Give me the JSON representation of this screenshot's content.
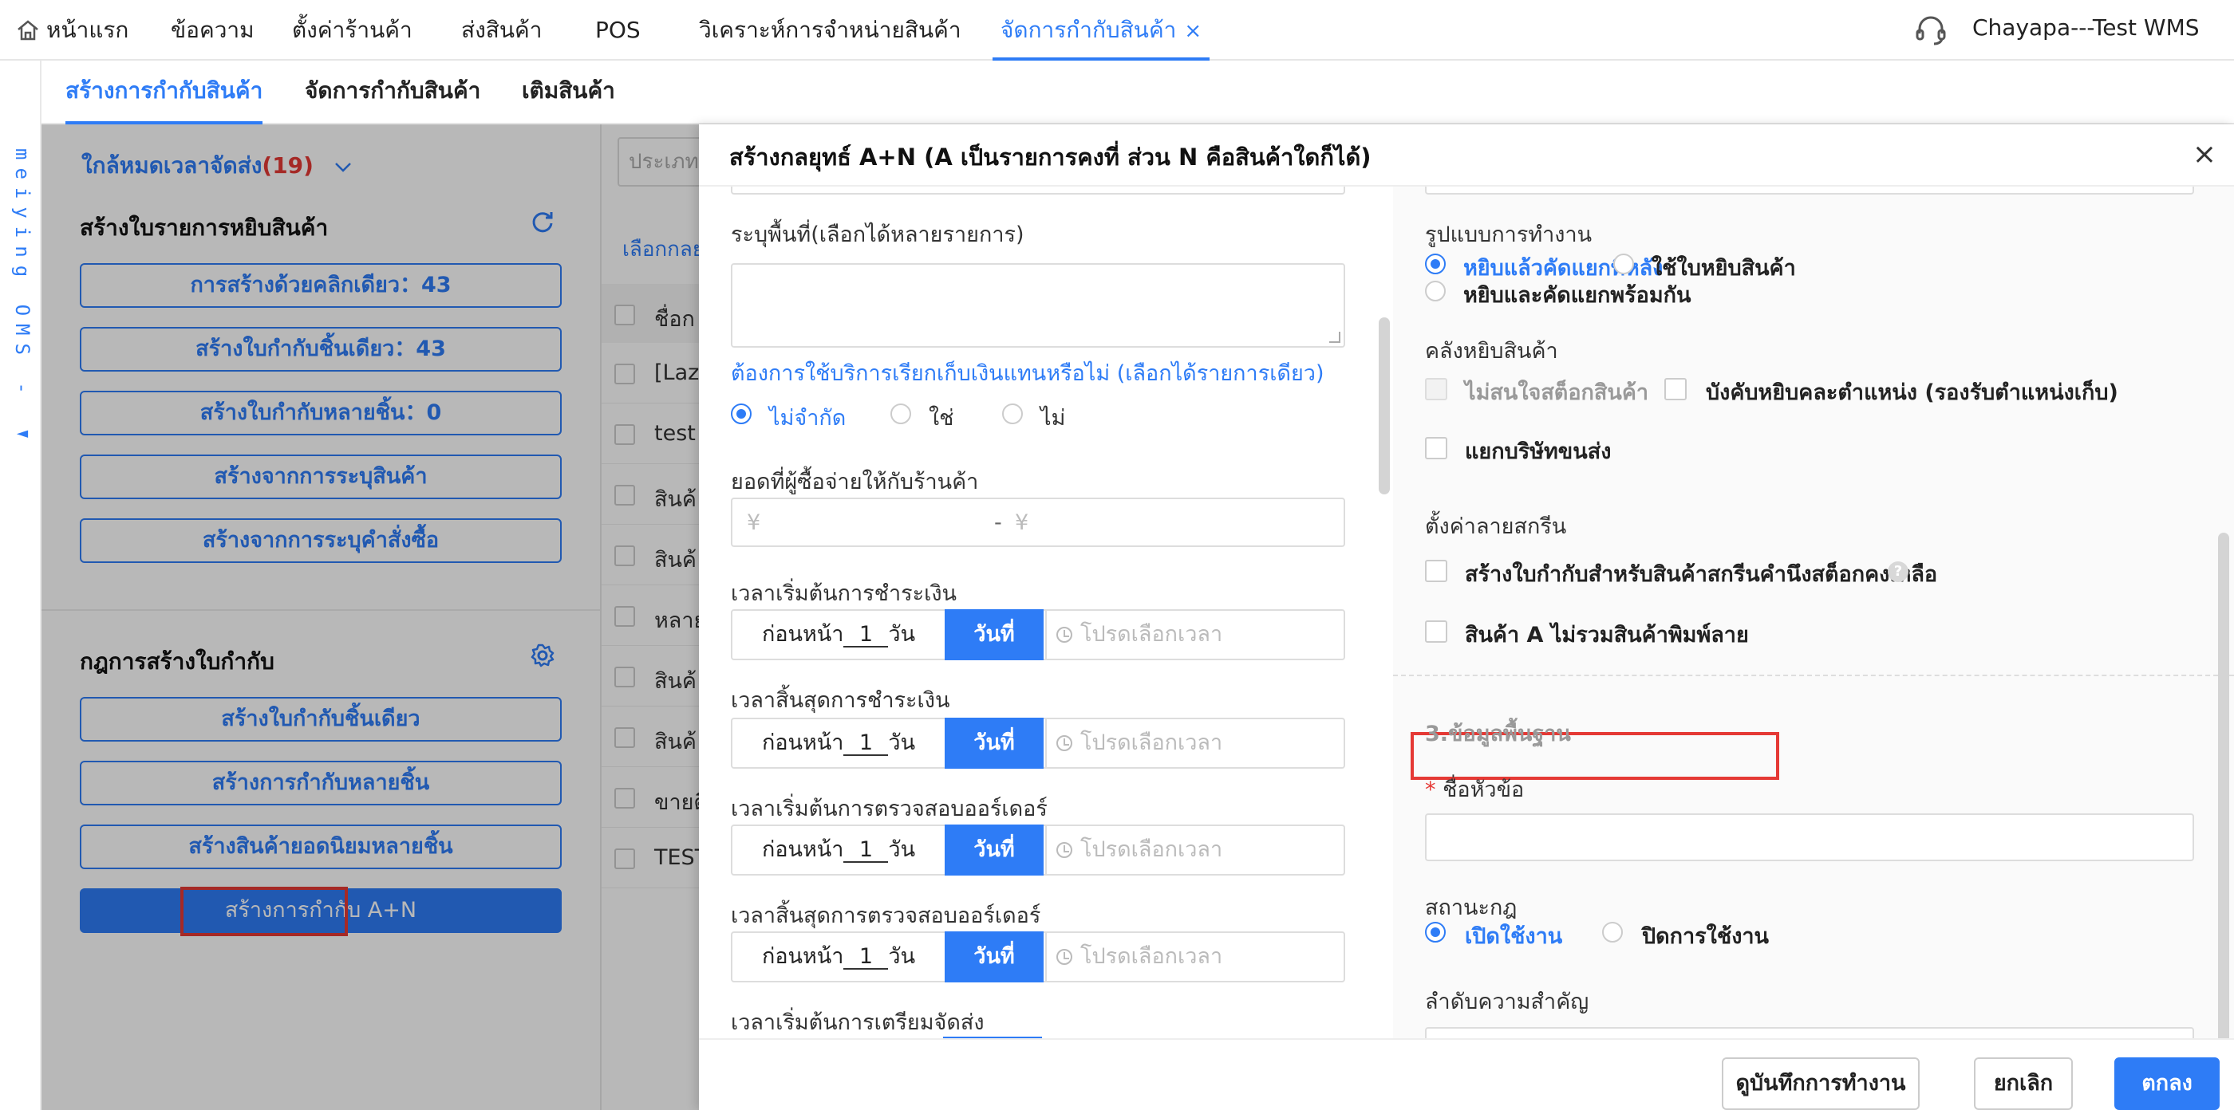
{
  "topnav": {
    "home": "หน้าแรก",
    "items": [
      "ข้อความ",
      "ตั้งค่าร้านค้า",
      "ส่งสินค้า",
      "POS",
      "วิเคราะห์การจำหน่ายสินค้า"
    ],
    "active": "จัดการกำกับสินค้า",
    "close": "×",
    "user": "Chayapa---Test WMS"
  },
  "vertical_text": "meiying OMS - ◄",
  "subtabs": [
    "สร้างการกำกับสินค้า",
    "จัดการกำกับสินค้า",
    "เติมสินค้า"
  ],
  "left": {
    "timeout_label": "ใกล้หมดเวลาจัดส่ง",
    "timeout_count": "(19)",
    "section1": "สร้างใบรายการหยิบสินค้า",
    "buttons1": [
      "การสร้างด้วยคลิกเดียว：43",
      "สร้างใบกำกับชิ้นเดียว：43",
      "สร้างใบกำกับหลายชิ้น：0",
      "สร้างจากการระบุสินค้า",
      "สร้างจากการระบุคำสั่งซื้อ"
    ],
    "section2": "กฎการสร้างใบกำกับ",
    "buttons2": [
      "สร้างใบกำกับชิ้นเดียว",
      "สร้างการกำกับหลายชิ้น",
      "สร้างสินค้ายอดนิยมหลายชิ้น"
    ],
    "primary_button": "สร้างการกำกับ A+N"
  },
  "middle": {
    "input_placeholder": "ประเภท",
    "link": "เลือกกลย",
    "header": "ชื่อก",
    "rows": [
      "[Laza",
      "test",
      "สินค้",
      "สินค้",
      "หลาย",
      "สินค้",
      "สินค้",
      "ขายดี",
      "TEST"
    ]
  },
  "modal": {
    "title": "สร้างกลยุทธ์ A+N   (A เป็นรายการคงที่ ส่วน N คือสินค้าใดก็ได้)",
    "close": "×",
    "left": {
      "area_label": "ระบุพื้นที่(เลือกได้หลายรายการ)",
      "cod_label": "ต้องการใช้บริการเรียกเก็บเงินแทนหรือไม่ (เลือกได้รายการเดียว)",
      "cod_options": [
        "ไม่จำกัด",
        "ใช่",
        "ไม่"
      ],
      "amount_label": "ยอดที่ผู้ซื้อจ่ายให้กับร้านค้า",
      "amount_from": "¥",
      "amount_sep": "-",
      "amount_to": "¥",
      "time_rows": [
        {
          "label": "เวลาเริ่มต้นการชำระเงิน",
          "pre": "ก่อนหน้า",
          "num": "1",
          "unit": "วัน",
          "day": "วันที่",
          "time": "โปรดเลือกเวลา"
        },
        {
          "label": "เวลาสิ้นสุดการชำระเงิน",
          "pre": "ก่อนหน้า",
          "num": "1",
          "unit": "วัน",
          "day": "วันที่",
          "time": "โปรดเลือกเวลา"
        },
        {
          "label": "เวลาเริ่มต้นการตรวจสอบออร์เดอร์",
          "pre": "ก่อนหน้า",
          "num": "1",
          "unit": "วัน",
          "day": "วันที่",
          "time": "โปรดเลือกเวลา"
        },
        {
          "label": "เวลาสิ้นสุดการตรวจสอบออร์เดอร์",
          "pre": "ก่อนหน้า",
          "num": "1",
          "unit": "วัน",
          "day": "วันที่",
          "time": "โปรดเลือกเวลา"
        }
      ],
      "last_label": "เวลาเริ่มต้นการเตรียมจัดส่ง"
    },
    "right": {
      "workmode_label": "รูปแบบการทำงาน",
      "workmode_options": [
        "หยิบแล้วคัดแยกทีหลัง",
        "ใช้ใบหยิบสินค้า",
        "หยิบและคัดแยกพร้อมกัน"
      ],
      "warehouse_label": "คลังหยิบสินค้า",
      "stock_option": "ไม่สนใจสต็อกสินค้า",
      "force_option": "บังคับหยิบคละตำแหน่ง (รองรับตำแหน่งเก็บ)",
      "carrier_option": "แยกบริษัทขนส่ง",
      "screen_label": "ตั้งค่าลายสกรีน",
      "screen_option1": "สร้างใบกำกับสำหรับสินค้าสกรีนคำนึงสต็อกคงเหลือ",
      "screen_option2": "สินค้า A ไม่รวมสินค้าพิมพ์ลาย",
      "help": "?",
      "basic_section": "3.ข้อมูลพื้นฐาน",
      "required_mark": "*",
      "name_label": "ชื่อหัวข้อ",
      "status_label": "สถานะกฎ",
      "status_options": [
        "เปิดใช้งาน",
        "ปิดการใช้งาน"
      ],
      "priority_label": "ลำดับความสำคัญ"
    },
    "footer": {
      "log": "ดูบันทึกการทำงาน",
      "cancel": "ยกเลิก",
      "ok": "ตกลง"
    }
  },
  "colors": {
    "accent": "#2e7cf6",
    "highlight": "#e53935"
  }
}
